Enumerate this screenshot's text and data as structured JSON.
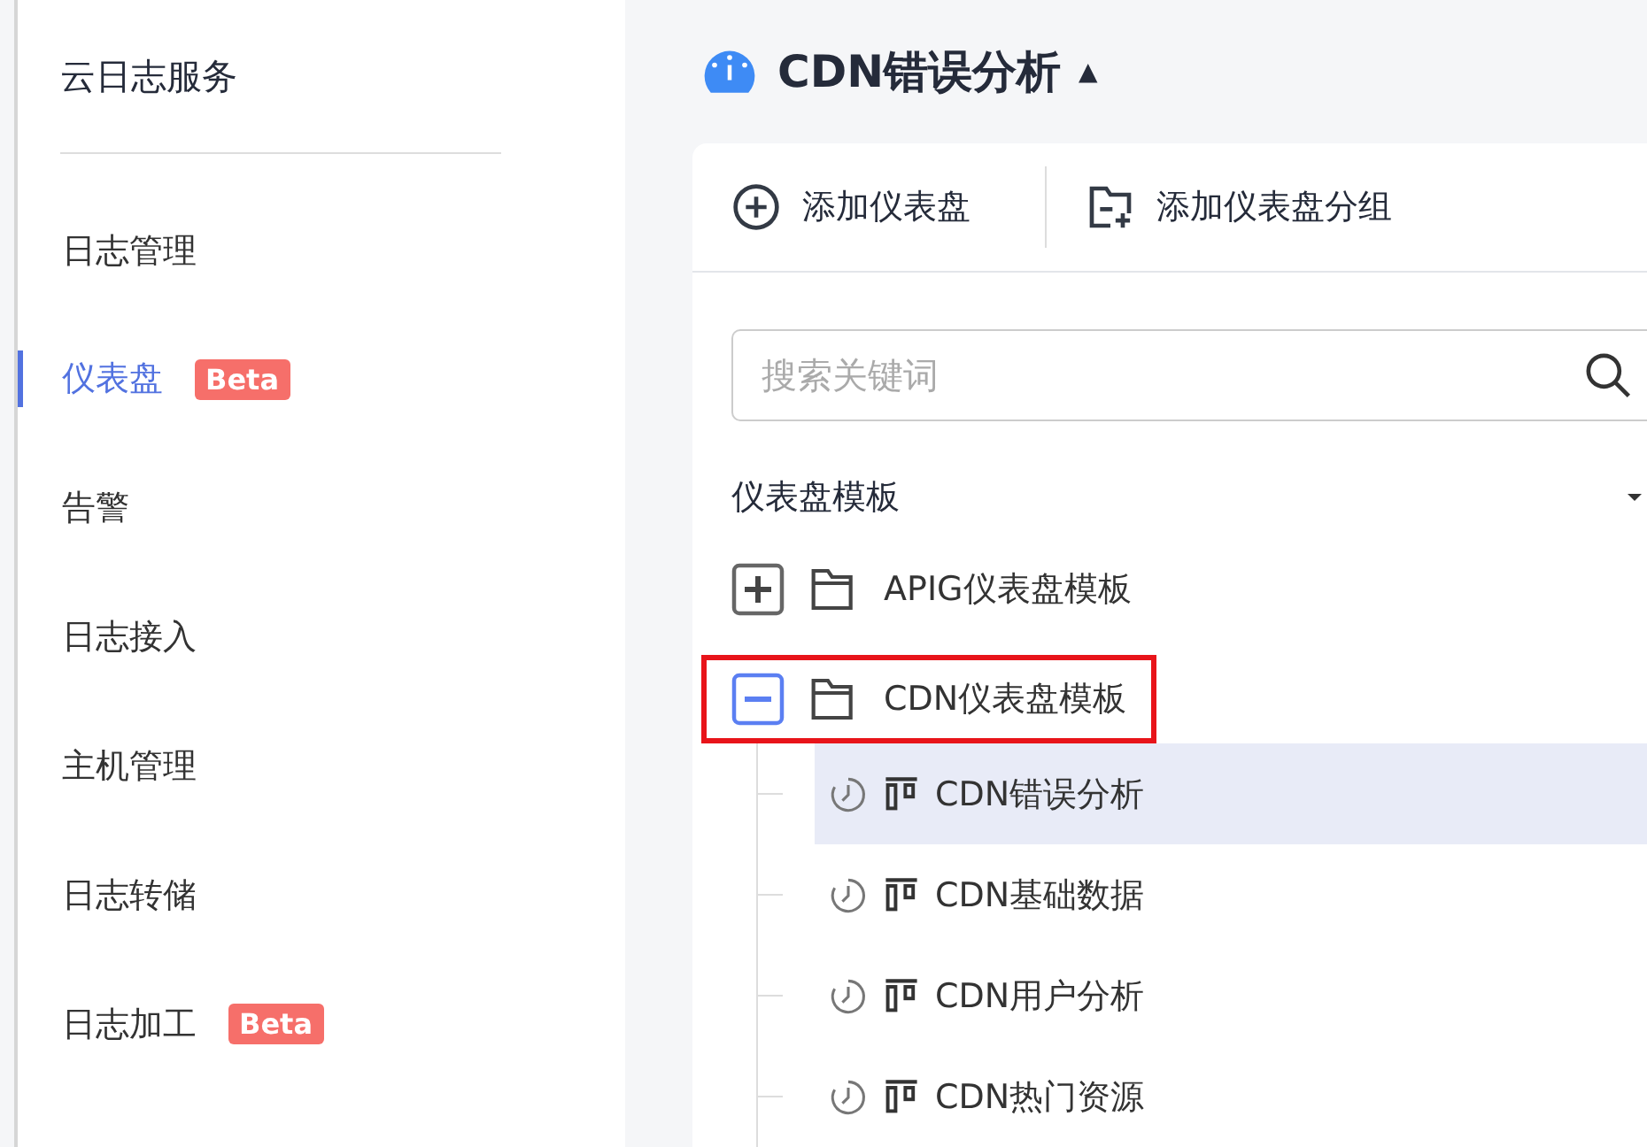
{
  "sidebar": {
    "title": "云日志服务",
    "items": [
      {
        "label": "日志管理",
        "selected": false
      },
      {
        "label": "仪表盘",
        "selected": true,
        "badge": "Beta"
      },
      {
        "label": "告警",
        "selected": false
      },
      {
        "label": "日志接入",
        "selected": false
      },
      {
        "label": "主机管理",
        "selected": false
      },
      {
        "label": "日志转储",
        "selected": false
      },
      {
        "label": "日志加工",
        "selected": false,
        "badge": "Beta"
      }
    ]
  },
  "header": {
    "title": "CDN错误分析",
    "caret": "▲"
  },
  "toolbar": {
    "buttons": [
      {
        "kind": "add",
        "label": "添加仪表盘"
      },
      {
        "kind": "group",
        "label": "添加仪表盘分组"
      }
    ]
  },
  "search": {
    "placeholder": "搜索关键词"
  },
  "section": {
    "title": "仪表盘模板",
    "expanded": true
  },
  "tree": [
    {
      "label": "APIG仪表盘模板",
      "expanded": false,
      "highlighted": false
    },
    {
      "label": "CDN仪表盘模板",
      "expanded": true,
      "highlighted": true,
      "children": [
        {
          "label": "CDN错误分析",
          "selected": true
        },
        {
          "label": "CDN基础数据",
          "selected": false
        },
        {
          "label": "CDN用户分析",
          "selected": false
        },
        {
          "label": "CDN热门资源",
          "selected": false
        }
      ]
    }
  ]
}
